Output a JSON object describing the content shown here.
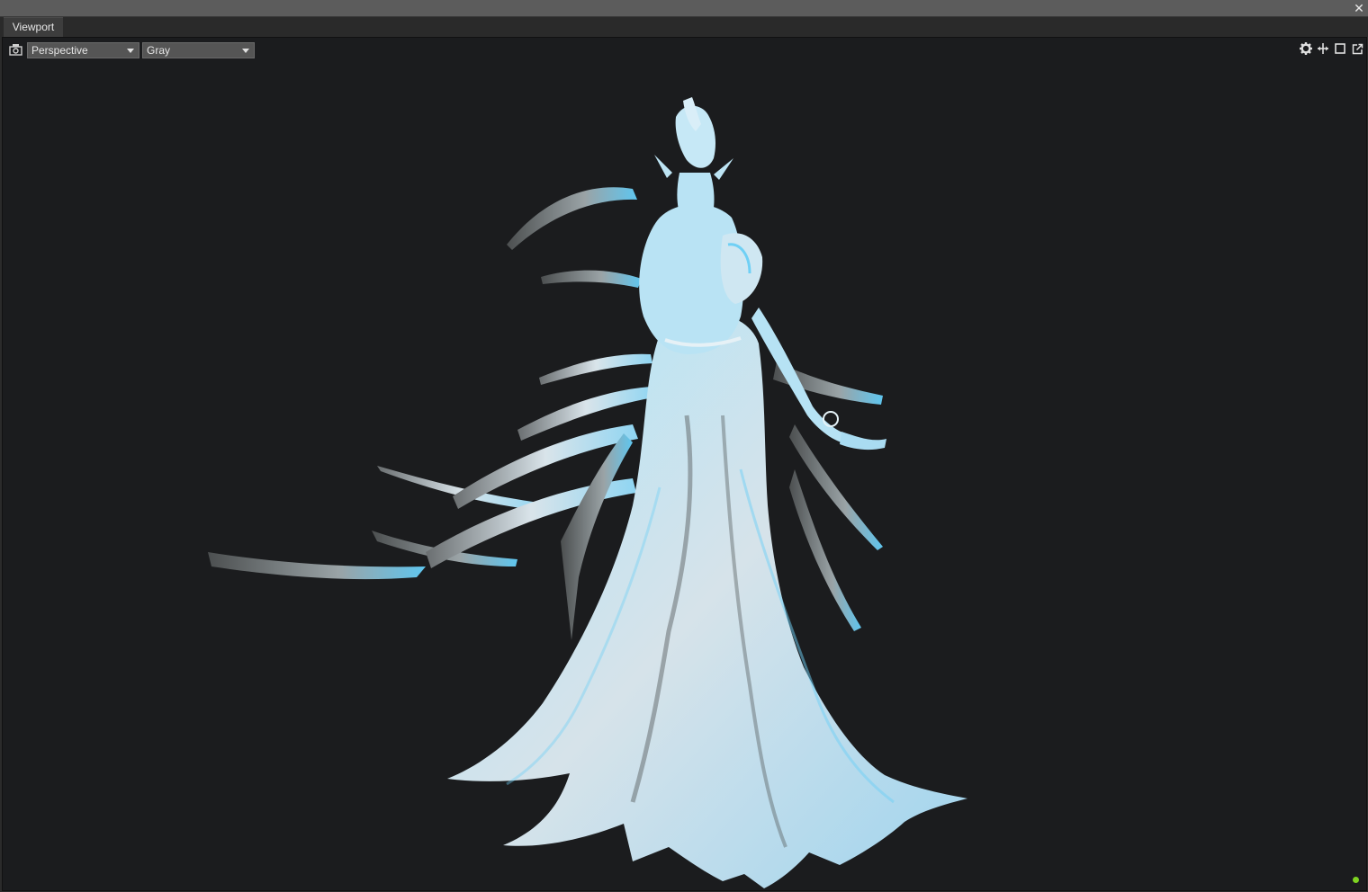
{
  "window": {
    "close_icon": "close-icon"
  },
  "tab": {
    "label": "Viewport"
  },
  "toolbar": {
    "camera_icon": "camera-icon",
    "camera_mode": "Perspective",
    "shading_mode": "Gray",
    "icons": [
      "gear-icon",
      "move-icon",
      "maximize-icon",
      "popout-icon"
    ]
  },
  "viewport": {
    "background_color": "#1b1c1e",
    "model_base_color": "#c9dbe6",
    "model_highlight_color": "#6fd0f5",
    "model_shadow_color": "#55595c"
  },
  "status": {
    "indicator_color": "#7ed321"
  }
}
